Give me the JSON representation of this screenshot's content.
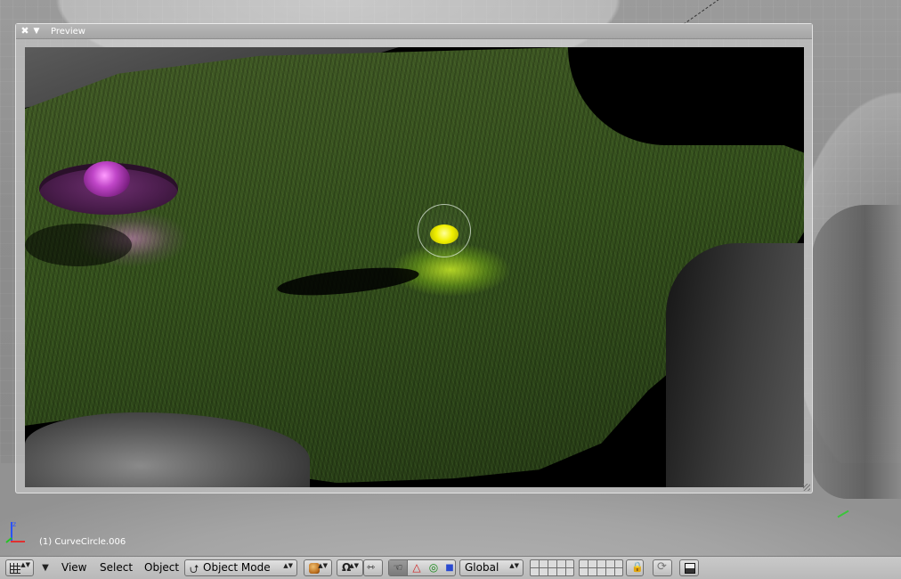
{
  "preview_panel": {
    "title": "Preview",
    "close_glyph": "✖",
    "collapse_glyph": "▼"
  },
  "viewport": {
    "object_info": "(1) CurveCircle.006",
    "axis_label": "z"
  },
  "header": {
    "editor_type_icon": "grid-icon",
    "collapse_glyph": "▼",
    "menus": [
      "View",
      "Select",
      "Object"
    ],
    "mode": "Object Mode",
    "mode_icon_glyph": "⮍",
    "pivot_glyph": "Ω",
    "align_glyph": "⇿",
    "manipulator_hand_glyph": "☜",
    "translate_glyph": "△",
    "rotate_glyph": "◎",
    "scale_glyph": "■",
    "orientation": "Global",
    "lock_glyph": "🔒",
    "link_glyph": "⟳",
    "updown_glyph": "▲▼"
  },
  "colors": {
    "header_bg": "#c4c4c4",
    "panel_header": "#adadad",
    "glow_yellow": "#f1f000",
    "glow_magenta": "#c046c8",
    "grass": "#34501c"
  }
}
